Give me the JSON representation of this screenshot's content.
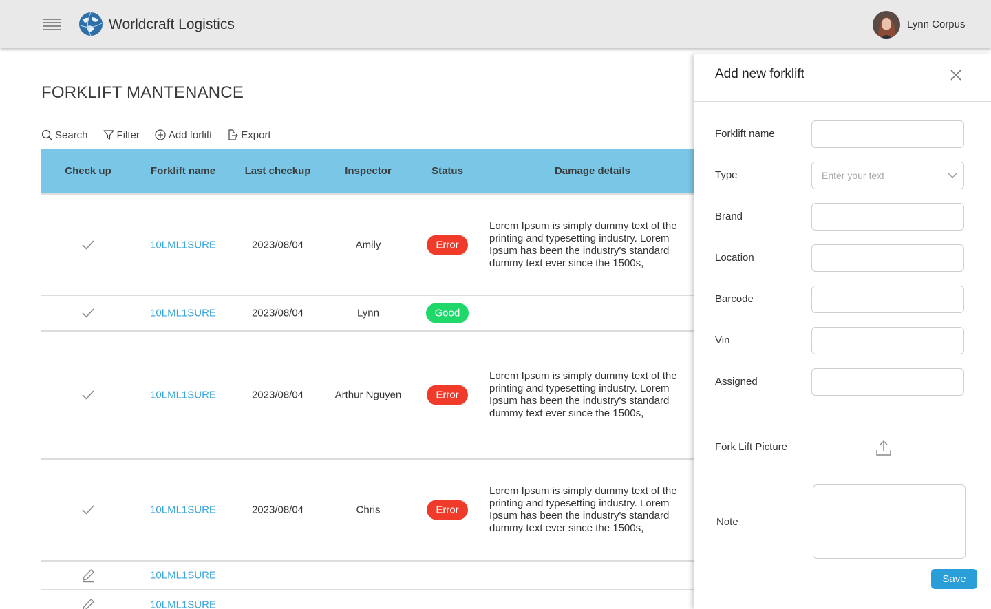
{
  "header": {
    "app_title": "Worldcraft Logistics",
    "user_name": "Lynn Corpus"
  },
  "page": {
    "title": "FORKLIFT MANTENANCE"
  },
  "toolbar": {
    "search": "Search",
    "filter": "Filter",
    "add": "Add forlift",
    "export": "Export"
  },
  "table": {
    "columns": [
      "Check up",
      "Forklift name",
      "Last checkup",
      "Inspector",
      "Status",
      "Damage details"
    ],
    "rows": [
      {
        "check_icon": "check-icon",
        "name": "10LML1SURE",
        "date": "2023/08/04",
        "inspector": "Amily",
        "status": "Error",
        "damage": "Lorem Ipsum is simply dummy text of the printing and typesetting industry. Lorem Ipsum has been the industry's standard dummy text ever since the 1500s,"
      },
      {
        "check_icon": "check-icon",
        "name": "10LML1SURE",
        "date": "2023/08/04",
        "inspector": "Lynn",
        "status": "Good",
        "damage": ""
      },
      {
        "check_icon": "check-icon",
        "name": "10LML1SURE",
        "date": "2023/08/04",
        "inspector": "Arthur Nguyen",
        "status": "Error",
        "damage": "Lorem Ipsum is simply dummy text of the printing and typesetting industry. Lorem Ipsum has been the industry's standard dummy text ever since the 1500s,"
      },
      {
        "check_icon": "check-icon",
        "name": "10LML1SURE",
        "date": "2023/08/04",
        "inspector": "Chris",
        "status": "Error",
        "damage": "Lorem Ipsum is simply dummy text of the printing and typesetting industry. Lorem Ipsum has been the industry's standard dummy text ever since the 1500s,"
      },
      {
        "check_icon": "pencil-icon",
        "name": "10LML1SURE",
        "date": "",
        "inspector": "",
        "status": "",
        "damage": ""
      },
      {
        "check_icon": "pencil-icon",
        "name": "10LML1SURE",
        "date": "",
        "inspector": "",
        "status": "",
        "damage": ""
      }
    ]
  },
  "drawer": {
    "title": "Add new forklift",
    "fields": {
      "name_label": "Forklift name",
      "type_label": "Type",
      "type_placeholder": "Enter your text",
      "brand_label": "Brand",
      "location_label": "Location",
      "barcode_label": "Barcode",
      "vin_label": "Vin",
      "assigned_label": "Assigned",
      "picture_label": "Fork Lift Picture",
      "note_label": "Note"
    },
    "save": "Save"
  },
  "colors": {
    "header_bg": "#e9e9ea",
    "table_header": "#79c6e6",
    "link": "#3aa5dc",
    "error": "#f03a2a",
    "good": "#1fd86a",
    "primary_button": "#2a9ed9"
  }
}
